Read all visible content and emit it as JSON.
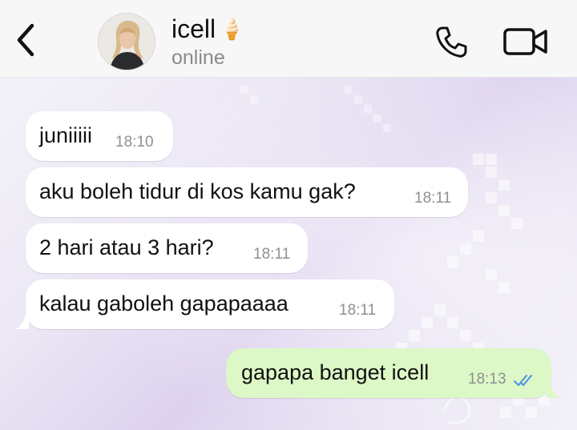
{
  "header": {
    "name": "icell",
    "name_emoji": "🍦",
    "status": "online",
    "icons": {
      "back": "chevron-left-icon",
      "call": "phone-icon",
      "video": "video-camera-icon"
    }
  },
  "messages": [
    {
      "direction": "incoming",
      "text": "juniiiii",
      "time": "18:10"
    },
    {
      "direction": "incoming",
      "text": "aku boleh tidur di kos kamu gak?",
      "time": "18:11"
    },
    {
      "direction": "incoming",
      "text": "2 hari atau 3 hari?",
      "time": "18:11"
    },
    {
      "direction": "incoming",
      "text": "kalau gaboleh gapapaaaa",
      "time": "18:11"
    },
    {
      "direction": "outgoing",
      "text": "gapapa banget icell",
      "time": "18:13",
      "read_receipt": "double-check-read"
    }
  ],
  "colors": {
    "incoming_bubble": "#ffffff",
    "outgoing_bubble": "#dcf8c6",
    "read_tick": "#4a90e2",
    "header_bg": "#f7f7f7"
  }
}
